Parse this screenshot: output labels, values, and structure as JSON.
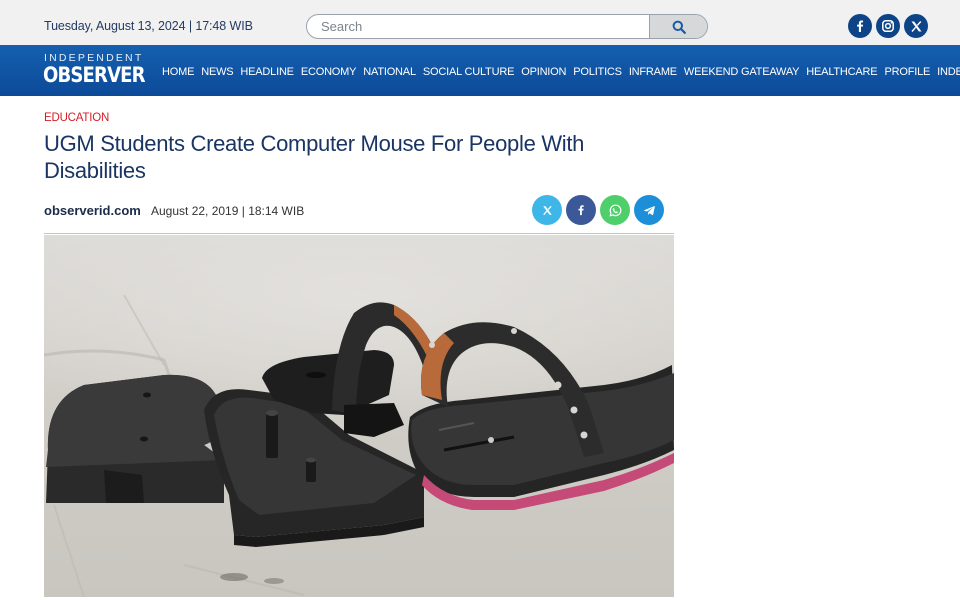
{
  "topbar": {
    "date": "Tuesday, August 13, 2024 | 17:48 WIB",
    "search_placeholder": "Search",
    "search_icon": "search-icon",
    "social": [
      "facebook-icon",
      "instagram-icon",
      "x-icon"
    ]
  },
  "nav": {
    "logo_small": "INDEPENDENT",
    "logo_big": "OBSERVER",
    "items": [
      "HOME",
      "NEWS",
      "HEADLINE",
      "ECONOMY",
      "NATIONAL",
      "SOCIAL CULTURE",
      "OPINION",
      "POLITICS",
      "INFRAME",
      "WEEKEND GATEAWAY",
      "HEALTHCARE",
      "PROFILE",
      "INDEX"
    ]
  },
  "article": {
    "category": "EDUCATION",
    "title": "UGM Students Create Computer Mouse For People With Disabilities",
    "source": "observerid.com",
    "date": "August 22, 2019 | 18:14 WIB",
    "share_icons": [
      "x-icon",
      "facebook-icon",
      "whatsapp-icon",
      "telegram-icon"
    ]
  },
  "colors": {
    "nav_blue": "#0d4488",
    "accent_red": "#d21f27",
    "share_x": "#3fb6e8",
    "share_facebook": "#3b5998",
    "share_whatsapp": "#4fcf6b",
    "share_telegram": "#1c8fd8"
  }
}
